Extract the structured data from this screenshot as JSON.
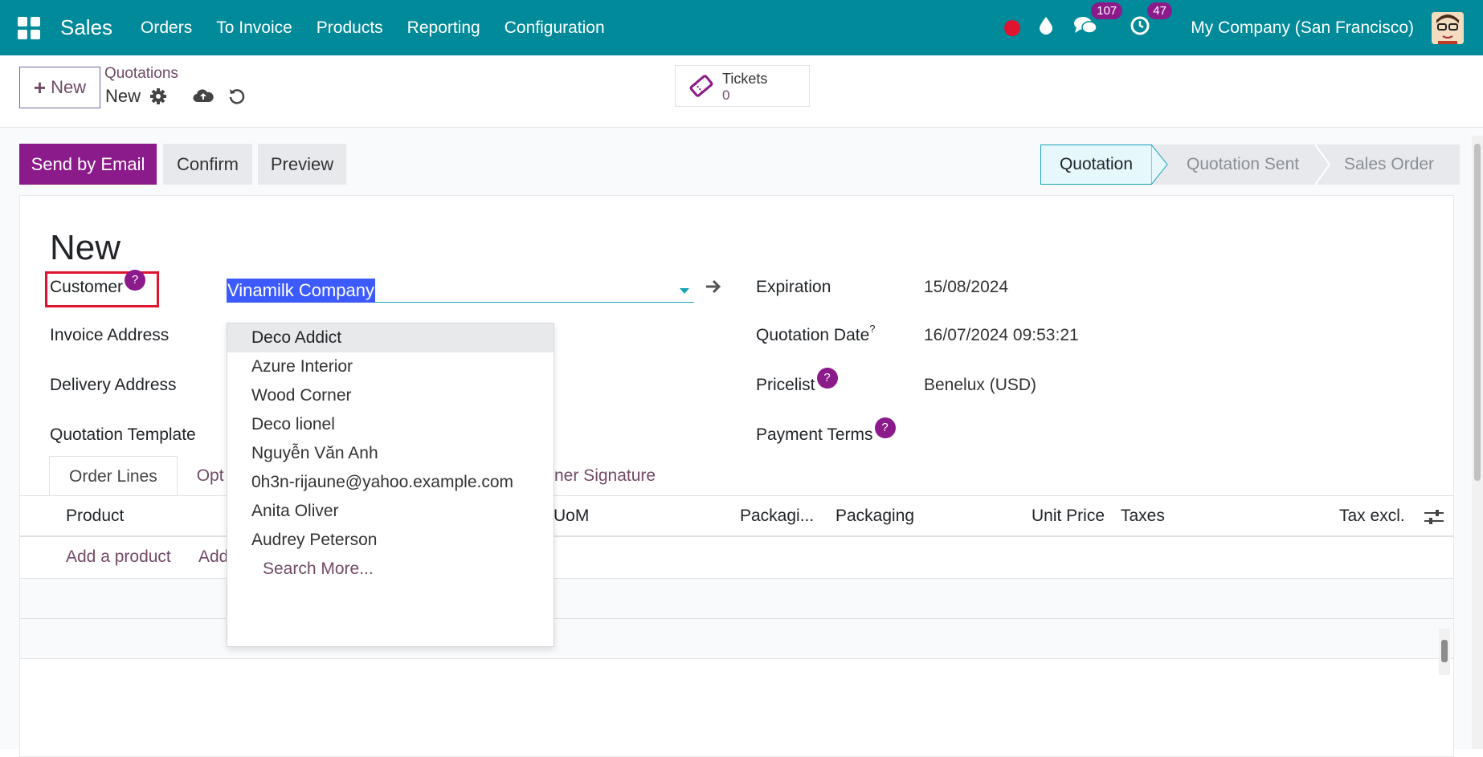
{
  "navbar": {
    "brand": "Sales",
    "menu": [
      "Orders",
      "To Invoice",
      "Products",
      "Reporting",
      "Configuration"
    ],
    "messages_count": "107",
    "activities_count": "47",
    "company": "My Company (San Francisco)"
  },
  "control": {
    "new_label": "New",
    "breadcrumb_parent": "Quotations",
    "breadcrumb_current": "New",
    "tickets_label": "Tickets",
    "tickets_count": "0"
  },
  "actions": {
    "send_email": "Send by Email",
    "confirm": "Confirm",
    "preview": "Preview"
  },
  "statusbar": [
    "Quotation",
    "Quotation Sent",
    "Sales Order"
  ],
  "form": {
    "title": "New",
    "customer_label": "Customer",
    "customer_value": "Vinamilk Company",
    "invoice_address_label": "Invoice Address",
    "delivery_address_label": "Delivery Address",
    "template_label": "Quotation Template",
    "expiration_label": "Expiration",
    "expiration_value": "15/08/2024",
    "quotation_date_label": "Quotation Date",
    "quotation_date_value": "16/07/2024 09:53:21",
    "pricelist_label": "Pricelist",
    "pricelist_value": "Benelux (USD)",
    "payment_terms_label": "Payment Terms",
    "help_mark": "?"
  },
  "tabs": {
    "order_lines": "Order Lines",
    "optional_partial": "Opt",
    "signature_partial": "ner Signature"
  },
  "table": {
    "product": "Product",
    "uom_partial": "UoM",
    "packaging_qty": "Packagi...",
    "packaging": "Packaging",
    "unit_price": "Unit Price",
    "taxes": "Taxes",
    "tax_excl": "Tax excl.",
    "add_product": "Add a product",
    "add_partial": "Add"
  },
  "dropdown": {
    "items": [
      "Deco Addict",
      "Azure Interior",
      "Wood Corner",
      "Deco lionel",
      "Nguyễn Văn Anh",
      "0h3n-rijaune@yahoo.example.com",
      "Anita Oliver",
      "Audrey Peterson"
    ],
    "search_more": "Search More..."
  },
  "colors": {
    "navbar": "#018a99",
    "primary": "#8b1a8b",
    "link": "#714b67",
    "highlight": "#3d5afe",
    "alert": "#e0142f"
  }
}
